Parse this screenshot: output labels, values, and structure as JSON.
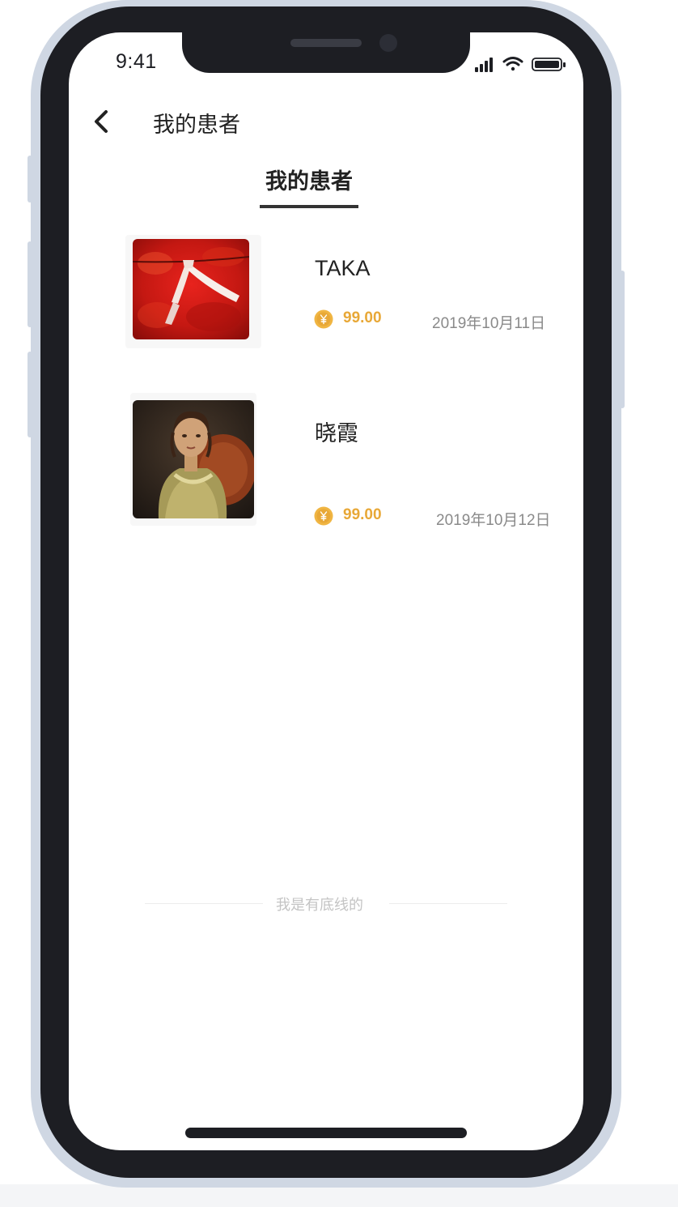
{
  "status_bar": {
    "time": "9:41"
  },
  "nav": {
    "title": "我的患者"
  },
  "tabs": [
    {
      "label": "我的患者",
      "active": true
    }
  ],
  "patients": [
    {
      "name": "TAKA",
      "amount": "99.00",
      "date": "2019年10月11日",
      "avatar": "red-maple-leaves-photo"
    },
    {
      "name": "晓霞",
      "amount": "99.00",
      "date": "2019年10月12日",
      "avatar": "portrait-painting-woman"
    }
  ],
  "footer": {
    "text": "我是有底线的"
  },
  "colors": {
    "accent": "#e8a837",
    "text": "#222222",
    "muted": "#8a8a8a",
    "bezel": "#1d1e23",
    "frame": "#cfd7e3"
  },
  "icons": {
    "back": "chevron-left-icon",
    "coin": "yuan-coin-icon",
    "signal": "signal-icon",
    "wifi": "wifi-icon",
    "battery": "battery-icon"
  }
}
